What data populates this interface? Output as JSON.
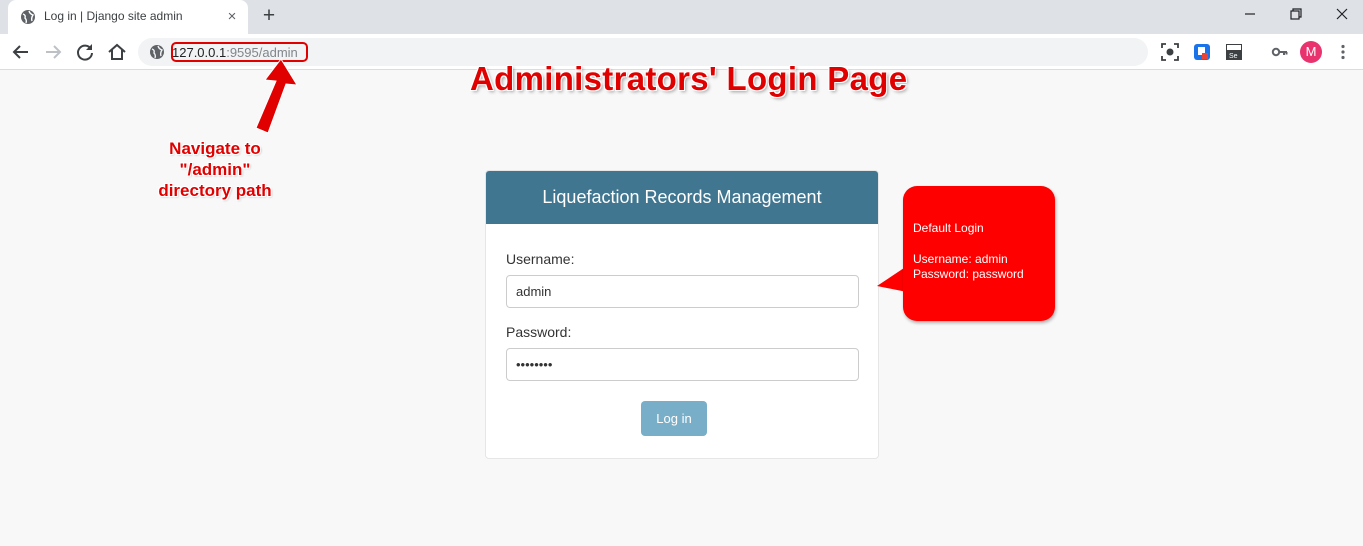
{
  "browser": {
    "tab": {
      "title": "Log in | Django site admin"
    },
    "new_tab": "+",
    "close_tab": "×",
    "url": {
      "host": "127.0.0.1",
      "rest": ":9595/admin"
    },
    "profile_initial": "M"
  },
  "annotations": {
    "title": "Administrators' Login Page",
    "nav_note": [
      "Navigate to",
      "\"/admin\"",
      "directory path"
    ],
    "callout": {
      "heading": "Default Login",
      "username_line": "Username: admin",
      "password_line": "Password: password"
    },
    "colors": {
      "annotation_red": "#e00000",
      "callout_bg": "#ff0000"
    }
  },
  "login": {
    "header": "Liquefaction Records Management",
    "username_label": "Username:",
    "username_value": "admin",
    "password_label": "Password:",
    "password_value": "password",
    "submit_label": "Log in",
    "colors": {
      "header_bg": "#417690",
      "button_bg": "#79aec8"
    }
  }
}
